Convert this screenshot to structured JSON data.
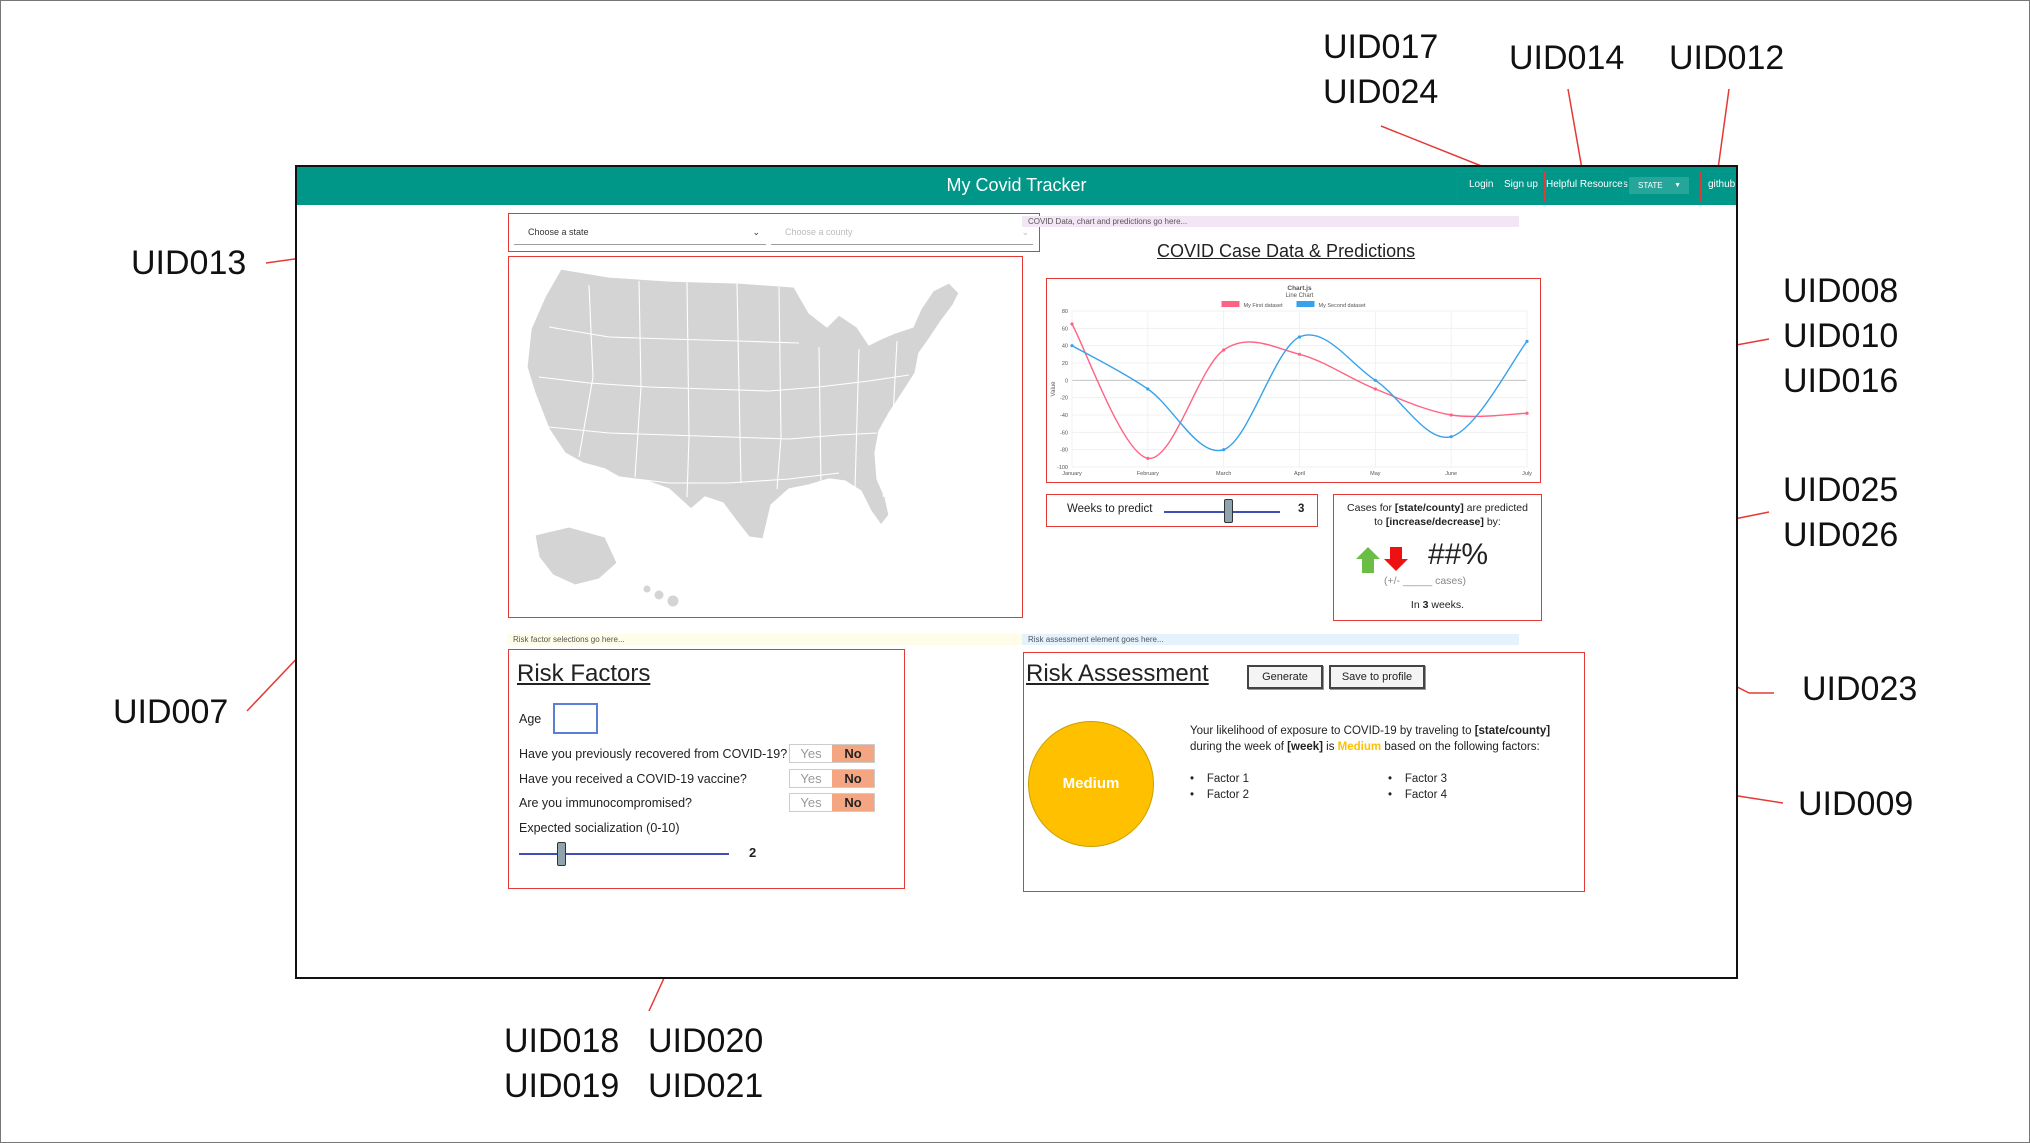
{
  "annotations": {
    "uid013": "UID013",
    "uid007": "UID007",
    "uid017_024": "UID017\nUID024",
    "uid014": "UID014",
    "uid012": "UID012",
    "uid008_010_016": "UID008\nUID010\nUID016",
    "uid025_026": "UID025\nUID026",
    "uid023": "UID023",
    "uid009": "UID009",
    "uid018_019": "UID018\nUID019",
    "uid020_021": "UID020\nUID021"
  },
  "header": {
    "title": "My Covid Tracker",
    "login": "Login",
    "signup": "Sign up",
    "resources": "Helpful Resources",
    "state_dropdown": "STATE",
    "github": "github"
  },
  "location": {
    "state_placeholder": "Choose a state",
    "county_placeholder": "Choose a county"
  },
  "strips": {
    "covid": "COVID Data, chart and predictions go here...",
    "risk_factor": "Risk factor selections go here...",
    "risk_assessment": "Risk assessment element goes here..."
  },
  "covid_panel": {
    "title": "COVID Case Data & Predictions"
  },
  "chart_data": {
    "type": "line",
    "title": "Chart.js",
    "subtitle": "Line Chart",
    "xlabel": "",
    "ylabel": "Value",
    "categories": [
      "January",
      "February",
      "March",
      "April",
      "May",
      "June",
      "July"
    ],
    "ylim": [
      -100,
      80
    ],
    "yticks": [
      80,
      60,
      40,
      20,
      0,
      -20,
      -40,
      -60,
      -80,
      -100
    ],
    "grid": true,
    "legend": "top-center",
    "series": [
      {
        "name": "My First dataset",
        "color": "#ff6384",
        "values": [
          65,
          -90,
          35,
          30,
          -10,
          -40,
          -38
        ]
      },
      {
        "name": "My Second dataset",
        "color": "#36a2eb",
        "values": [
          40,
          -10,
          -80,
          50,
          0,
          -65,
          45
        ]
      }
    ]
  },
  "prediction": {
    "weeks_label": "Weeks to predict",
    "weeks_value": "3",
    "weeks_slider_fraction": 0.55,
    "line1_prefix": "Cases for ",
    "line1_bold": "[state/county]",
    "line1_suffix": " are predicted",
    "line2_prefix": "to ",
    "line2_bold": "[increase/decrease]",
    "line2_suffix": " by:",
    "percent": "##%",
    "cases_line": "(+/- _____ cases)",
    "in_prefix": "In ",
    "in_weeks": "3",
    "in_suffix": " weeks.",
    "up_color": "#6abe45",
    "down_color": "#ee1111"
  },
  "risk_factors": {
    "title": "Risk Factors",
    "age_label": "Age",
    "age_value": "",
    "yes_label": "Yes",
    "no_label": "No",
    "questions": [
      "Have you previously recovered from COVID-19?",
      "Have you received a COVID-19 vaccine?",
      "Are you immunocompromised?"
    ],
    "socialization_label": "Expected socialization (0-10)",
    "socialization_value": "2",
    "socialization_fraction": 0.2
  },
  "risk_assessment": {
    "title": "Risk Assessment",
    "generate_label": "Generate",
    "save_label": "Save to profile",
    "level": "Medium",
    "level_color": "#ffc000",
    "text_prefix": "Your likelihood of exposure to COVID-19 by traveling to ",
    "text_location": "[state/county]",
    "text_mid": "during the week of ",
    "text_week": "[week]",
    "text_is": " is ",
    "text_level": "Medium",
    "text_suffix": " based on the following factors:",
    "factors": [
      "Factor 1",
      "Factor 2",
      "Factor 3",
      "Factor 4"
    ]
  }
}
